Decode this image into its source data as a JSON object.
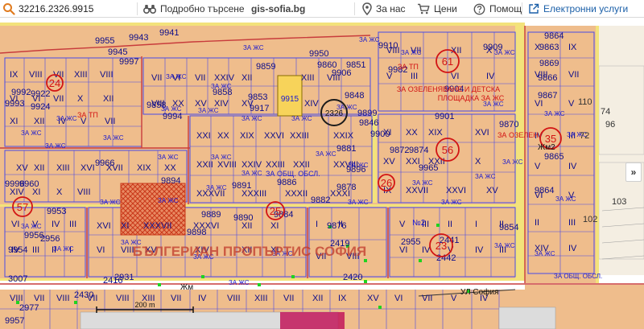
{
  "toolbar": {
    "search_value": "32216.2326.9915",
    "search_placeholder": "",
    "detail_search_label": "Подробно търсене",
    "brand": "gis-sofia.bg",
    "about_label": "За нас",
    "prices_label": "Цени",
    "help_label": "Помощ",
    "eservices_label": "Електронни услуги",
    "icons": {
      "search": "search-icon",
      "detail_search": "binoculars-icon",
      "about": "location-pin-icon",
      "prices": "cart-icon",
      "help": "help-icon",
      "eservices": "external-link-icon"
    }
  },
  "map": {
    "colors": {
      "parcel_fill": "#efbd8c",
      "green_zone": "#f4eee2",
      "road_yellow": "#f3e27b",
      "boundary": "#4a4ae6",
      "road_line": "#c83c3c",
      "red_label": "#d21414",
      "blue_label": "#1a1ad0",
      "dark_label": "#0d0d8a",
      "hatch": "#d34c2a",
      "selected_parcel": "#f7d35a",
      "focus_ring": "#1b1b1b",
      "green_marker": "#1fd31f"
    },
    "watermark": "БЪЛГЕРИАН ПРОПЪРТИС СОФИЯ",
    "street_label": "УЛ София",
    "scale_label": "200 m",
    "selected_id": "9915",
    "focus_id": "2326",
    "numbers": [
      {
        "t": "9955"
      },
      {
        "t": "9943"
      },
      {
        "t": "9941"
      },
      {
        "t": "9950"
      },
      {
        "t": "9945"
      },
      {
        "t": "9997"
      },
      {
        "t": "9860"
      },
      {
        "t": "9851"
      },
      {
        "t": "9859"
      },
      {
        "t": "9906"
      },
      {
        "t": "9910"
      },
      {
        "t": "9909"
      },
      {
        "t": "9864"
      },
      {
        "t": "9982"
      },
      {
        "t": "9848"
      },
      {
        "t": "9992"
      },
      {
        "t": "9853"
      },
      {
        "t": "9917"
      },
      {
        "t": "9904"
      },
      {
        "t": "9869"
      },
      {
        "t": "9858"
      },
      {
        "t": "9994"
      },
      {
        "t": "9901"
      },
      {
        "t": "9846"
      },
      {
        "t": "9900"
      },
      {
        "t": "9881"
      },
      {
        "t": "9874"
      },
      {
        "t": "9870"
      },
      {
        "t": "9966"
      },
      {
        "t": "9996"
      },
      {
        "t": "9891"
      },
      {
        "t": "9886"
      },
      {
        "t": "9882"
      },
      {
        "t": "9878"
      },
      {
        "t": "9872"
      },
      {
        "t": "9864"
      },
      {
        "t": "9960"
      },
      {
        "t": "9953"
      },
      {
        "t": "9876"
      },
      {
        "t": "9890"
      },
      {
        "t": "9884"
      },
      {
        "t": "9889"
      },
      {
        "t": "9956"
      },
      {
        "t": "9954"
      },
      {
        "t": "9965"
      },
      {
        "t": "2955"
      },
      {
        "t": "2419"
      },
      {
        "t": "2441"
      },
      {
        "t": "2442"
      },
      {
        "t": "2420"
      },
      {
        "t": "2956"
      },
      {
        "t": "2931"
      },
      {
        "t": "3007"
      },
      {
        "t": "2430"
      },
      {
        "t": "2416"
      },
      {
        "t": "2977"
      },
      {
        "t": "9898"
      },
      {
        "t": "9858"
      },
      {
        "t": "9993"
      },
      {
        "t": "9863"
      },
      {
        "t": "9866"
      },
      {
        "t": "9867"
      },
      {
        "t": "9865"
      },
      {
        "t": "9854"
      },
      {
        "t": "9924"
      },
      {
        "t": "9922"
      },
      {
        "t": "9899"
      },
      {
        "t": "9894"
      },
      {
        "t": "9896"
      },
      {
        "t": "9957"
      }
    ],
    "red_circles": [
      {
        "t": "61"
      },
      {
        "t": "56"
      },
      {
        "t": "35"
      },
      {
        "t": "57"
      },
      {
        "t": "23"
      },
      {
        "t": "24"
      },
      {
        "t": "25"
      },
      {
        "t": "26"
      }
    ],
    "right_numbers": [
      "74",
      "72",
      "103",
      "102",
      "110",
      "96"
    ],
    "labels": {
      "green_zone_1": "ЗА ОЗЕЛЕНЯВАНЕ И ДЕТСКА",
      "green_zone_2": "ПЛОЩАДКА ЗА ЖС",
      "ozel": "ЗА ОЗЕЛЕН.",
      "obsh_obsl": "ЗА ОБЩ. ОБСЛ.",
      "za_zhs": "ЗА ЖС",
      "zhm2": "Жм2",
      "zhm": "Жм",
      "no2": "№2",
      "za_tp": "ЗА ТП",
      "ta_tp": "ЗА ТП"
    }
  }
}
